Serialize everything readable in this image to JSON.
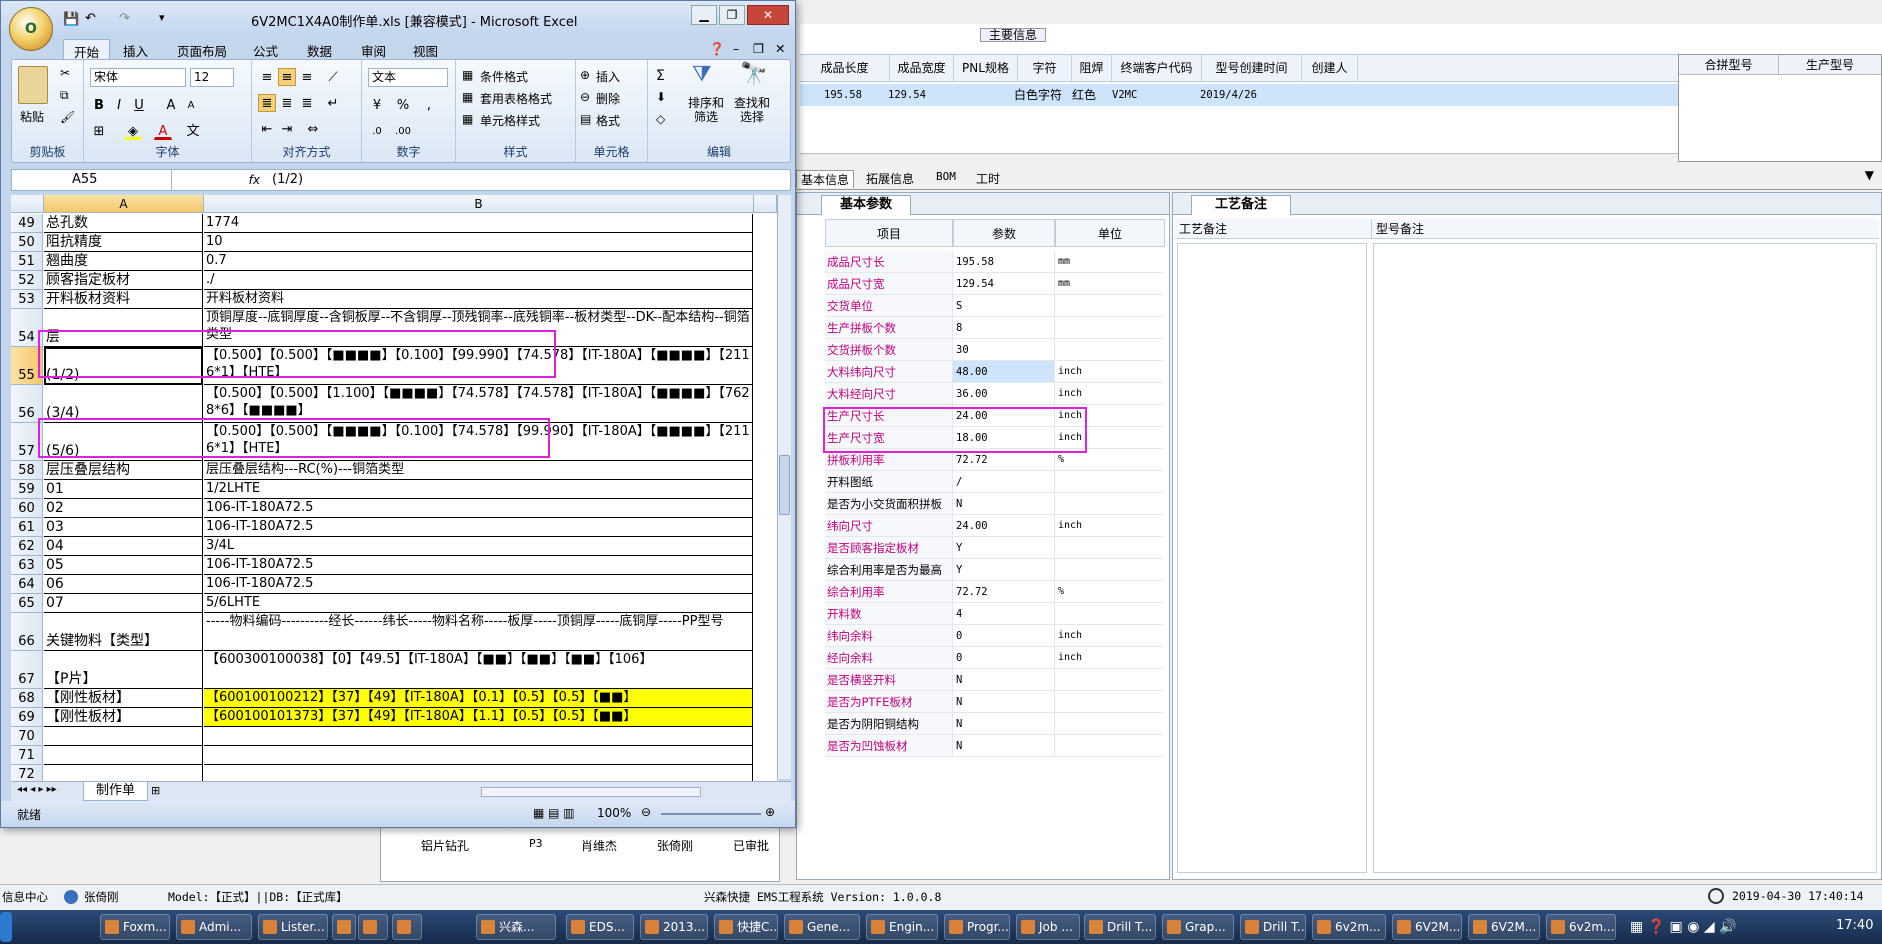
{
  "excel": {
    "title": "6V2MC1X4A0制作单.xls  [兼容模式] - Microsoft Excel",
    "orb": "O",
    "tabs": [
      "开始",
      "插入",
      "页面布局",
      "公式",
      "数据",
      "审阅",
      "视图"
    ],
    "clipboard": {
      "paste": "粘贴",
      "label": "剪贴板"
    },
    "font": {
      "name": "宋体",
      "size": "12",
      "label": "字体"
    },
    "alignment_label": "对齐方式",
    "number": {
      "format": "文本",
      "label": "数字"
    },
    "styles": {
      "items": [
        "条件格式",
        "套用表格格式",
        "单元格样式"
      ],
      "label": "样式"
    },
    "cells": {
      "items": [
        "插入",
        "删除",
        "格式"
      ],
      "label": "单元格"
    },
    "editing": {
      "sort": "排序和\n筛选",
      "find": "查找和\n选择",
      "label": "编辑"
    },
    "name_box": "A55",
    "fx": "fx",
    "formula": "(1/2)",
    "columns": [
      "A",
      "B"
    ],
    "rows": [
      {
        "n": "49",
        "a": "总孔数",
        "b": "1774"
      },
      {
        "n": "50",
        "a": "阻抗精度",
        "b": "10"
      },
      {
        "n": "51",
        "a": "翘曲度",
        "b": "0.7"
      },
      {
        "n": "52",
        "a": "顾客指定板材",
        "b": "./"
      },
      {
        "n": "53",
        "a": "开料板材资料",
        "b": "开料板材资料"
      },
      {
        "n": "54",
        "a": "层",
        "b": "顶铜厚度--底铜厚度--含铜板厚--不含铜厚--顶残铜率--底残铜率--板材类型--DK--配本结构--铜箔类型"
      },
      {
        "n": "55",
        "a": "(1/2)",
        "b": "【0.500】【0.500】【■■■■】【0.100】【99.990】【74.578】【IT-180A】【■■■■】【2116*1】【HTE】"
      },
      {
        "n": "56",
        "a": "(3/4)",
        "b": "【0.500】【0.500】【1.100】【■■■■】【74.578】【74.578】【IT-180A】【■■■■】【7628*6】【■■■■】"
      },
      {
        "n": "57",
        "a": "(5/6)",
        "b": "【0.500】【0.500】【■■■■】【0.100】【74.578】【99.990】【IT-180A】【■■■■】【2116*1】【HTE】"
      },
      {
        "n": "58",
        "a": "层压叠层结构",
        "b": "层压叠层结构---RC(%)---铜箔类型"
      },
      {
        "n": "59",
        "a": "01",
        "b": "1/2LHTE"
      },
      {
        "n": "60",
        "a": "02",
        "b": "106-IT-180A72.5"
      },
      {
        "n": "61",
        "a": "03",
        "b": "106-IT-180A72.5"
      },
      {
        "n": "62",
        "a": "04",
        "b": "3/4L"
      },
      {
        "n": "63",
        "a": "05",
        "b": "106-IT-180A72.5"
      },
      {
        "n": "64",
        "a": "06",
        "b": "106-IT-180A72.5"
      },
      {
        "n": "65",
        "a": "07",
        "b": "5/6LHTE"
      },
      {
        "n": "66",
        "a": "关键物料【类型】",
        "b": "-----物料编码----------经长------纬长-----物料名称-----板厚-----顶铜厚-----底铜厚-----PP型号"
      },
      {
        "n": "67",
        "a": "【P片】",
        "b": "【600300100038】【0】【49.5】【IT-180A】【■■】【■■】【■■】【106】"
      },
      {
        "n": "68",
        "a": "【刚性板材】",
        "b": "【600100100212】【37】【49】【IT-180A】【0.1】【0.5】【0.5】【■■】"
      },
      {
        "n": "69",
        "a": "【刚性板材】",
        "b": "【600100101373】【37】【49】【IT-180A】【1.1】【0.5】【0.5】【■■】"
      },
      {
        "n": "70",
        "a": "",
        "b": ""
      },
      {
        "n": "71",
        "a": "",
        "b": ""
      },
      {
        "n": "72",
        "a": "",
        "b": ""
      }
    ],
    "sheet_tab": "制作单",
    "status": "就绪",
    "zoom": "100%"
  },
  "app": {
    "group_header": "主要信息",
    "headers": [
      "成品长度",
      "成品宽度",
      "PNL规格",
      "字符",
      "阻焊",
      "终端客户代码",
      "型号创建时间",
      "创建人"
    ],
    "row": [
      "195.58",
      "129.54",
      "",
      "白色字符",
      "红色",
      "V2MC",
      "2019/4/26",
      ""
    ],
    "right_headers": [
      "合拼型号",
      "生产型号"
    ],
    "tabs": [
      "基本信息",
      "拓展信息",
      "BOM",
      "工时"
    ],
    "panel_tab": "基本参数",
    "param_headers": [
      "项目",
      "参数",
      "单位"
    ],
    "params": [
      {
        "item": "成品尺寸长",
        "value": "195.58",
        "unit": "mm",
        "pink": true
      },
      {
        "item": "成品尺寸宽",
        "value": "129.54",
        "unit": "mm",
        "pink": true
      },
      {
        "item": "交货单位",
        "value": "S",
        "unit": "",
        "pink": true
      },
      {
        "item": "生产拼板个数",
        "value": "8",
        "unit": "",
        "pink": true
      },
      {
        "item": "交货拼板个数",
        "value": "30",
        "unit": "",
        "pink": true
      },
      {
        "item": "大料纬向尺寸",
        "value": "48.00",
        "unit": "inch",
        "pink": true
      },
      {
        "item": "大料经向尺寸",
        "value": "36.00",
        "unit": "inch",
        "pink": true
      },
      {
        "item": "生产尺寸长",
        "value": "24.00",
        "unit": "inch",
        "pink": true
      },
      {
        "item": "生产尺寸宽",
        "value": "18.00",
        "unit": "inch",
        "pink": true
      },
      {
        "item": "拼板利用率",
        "value": "72.72",
        "unit": "%",
        "pink": true
      },
      {
        "item": "开料图纸",
        "value": "/",
        "unit": "",
        "pink": false
      },
      {
        "item": "是否为小交货面积拼板",
        "value": "N",
        "unit": "",
        "pink": false
      },
      {
        "item": "纬向尺寸",
        "value": "24.00",
        "unit": "inch",
        "pink": true
      },
      {
        "item": "是否顾客指定板材",
        "value": "Y",
        "unit": "",
        "pink": true
      },
      {
        "item": "综合利用率是否为最高",
        "value": "Y",
        "unit": "",
        "pink": false
      },
      {
        "item": "综合利用率",
        "value": "72.72",
        "unit": "%",
        "pink": true
      },
      {
        "item": "开料数",
        "value": "4",
        "unit": "",
        "pink": true
      },
      {
        "item": "纬向余料",
        "value": "0",
        "unit": "inch",
        "pink": true
      },
      {
        "item": "经向余料",
        "value": "0",
        "unit": "inch",
        "pink": true
      },
      {
        "item": "是否横竖开料",
        "value": "N",
        "unit": "",
        "pink": true
      },
      {
        "item": "是否为PTFE板材",
        "value": "N",
        "unit": "",
        "pink": true
      },
      {
        "item": "是否为阴阳铜结构",
        "value": "N",
        "unit": "",
        "pink": false
      },
      {
        "item": "是否为凹蚀板材",
        "value": "N",
        "unit": "",
        "pink": true
      }
    ],
    "right_panel_tab": "工艺备注",
    "right_cols": [
      "工艺备注",
      "型号备注"
    ],
    "bg_tree": [
      {
        "name": "铝片钻孔",
        "code": "P3",
        "p1": "肖维杰",
        "p2": "张倚刚",
        "s": "已审批"
      }
    ],
    "status": {
      "left": "信息中心",
      "user": "张倚刚",
      "model": "Model:【正式】||DB:【正式库】",
      "system": "兴森快捷 EMS工程系统 Version: 1.0.0.8",
      "time": "2019-04-30 17:40:14"
    }
  },
  "taskbar": {
    "items": [
      "Foxm...",
      "Admi...",
      "Lister...",
      "",
      "",
      "",
      "兴森...",
      "EDS...",
      "2013...",
      "快捷C...",
      "Gene...",
      "Engin...",
      "Progr...",
      "Job ...",
      "Drill T...",
      "Grap...",
      "Drill T...",
      "6v2m...",
      "6V2M...",
      "6V2M...",
      "6v2m..."
    ],
    "clock": "17:40"
  }
}
